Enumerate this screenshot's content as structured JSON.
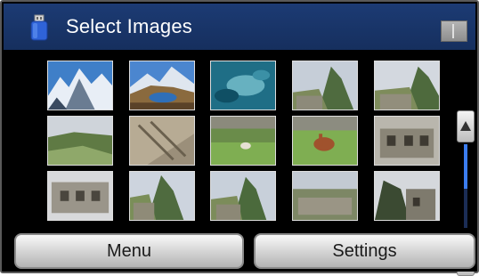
{
  "header": {
    "title": "Select Images",
    "usb_icon": "usb-memory-stick-icon"
  },
  "colors": {
    "header_bg": "#1c3b74",
    "scroll_thumb": "#3b7df0",
    "button_face": "#d2d2d2"
  },
  "thumbnails": [
    {
      "scene": "snowy-mountains"
    },
    {
      "scene": "mountain-lake"
    },
    {
      "scene": "aerial-water"
    },
    {
      "scene": "machu-picchu-peak"
    },
    {
      "scene": "machu-picchu-terraces"
    },
    {
      "scene": "grassy-hillside"
    },
    {
      "scene": "stone-stairs"
    },
    {
      "scene": "llama-on-grass"
    },
    {
      "scene": "llamas-grazing"
    },
    {
      "scene": "stone-walls"
    },
    {
      "scene": "stone-building"
    },
    {
      "scene": "ruins-with-peaks"
    },
    {
      "scene": "machu-picchu-overview"
    },
    {
      "scene": "ruins-rows"
    },
    {
      "scene": "ruins-in-trees"
    }
  ],
  "scrollbar": {
    "up_icon": "arrow-up-icon",
    "down_icon": "arrow-down-icon",
    "position_fraction": 0.0,
    "visible_fraction": 0.45
  },
  "buttons": {
    "menu": "Menu",
    "settings": "Settings"
  }
}
